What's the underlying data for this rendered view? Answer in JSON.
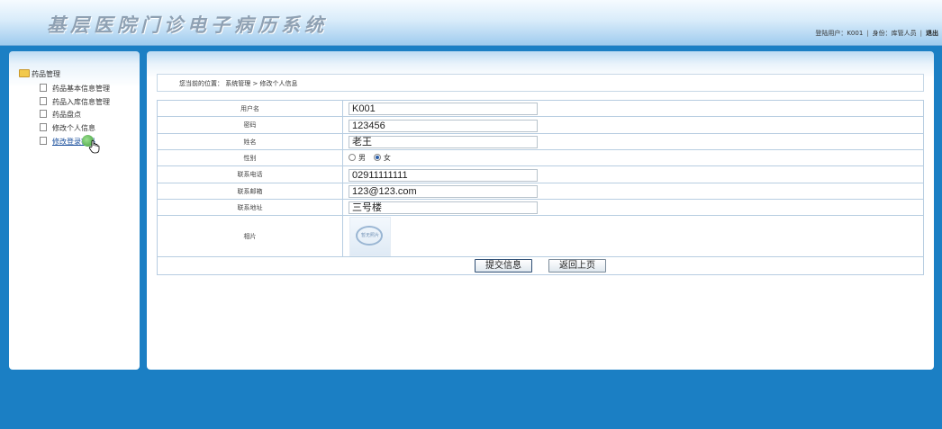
{
  "header": {
    "title": "基层医院门诊电子病历系统",
    "user_label": "登陆用户：K001",
    "role_label": "身份：库管人员",
    "logout": "退出"
  },
  "sidebar": {
    "root_label": "药品管理",
    "items": [
      {
        "label": "药品基本信息管理"
      },
      {
        "label": "药品入库信息管理"
      },
      {
        "label": "药品盘点"
      },
      {
        "label": "修改个人信息"
      },
      {
        "label": "修改登录密码"
      }
    ]
  },
  "breadcrumb": "您当前的位置：  系统管理 > 修改个人信息",
  "form": {
    "username": {
      "label": "用户名",
      "value": "K001"
    },
    "password": {
      "label": "密码",
      "value": "123456"
    },
    "name": {
      "label": "姓名",
      "value": "老王"
    },
    "gender": {
      "label": "性别",
      "male": "男",
      "female": "女",
      "selected": "女"
    },
    "phone": {
      "label": "联系电话",
      "value": "02911111111"
    },
    "email": {
      "label": "联系邮箱",
      "value": "123@123.com"
    },
    "address": {
      "label": "联系地址",
      "value": "三号楼"
    },
    "photo": {
      "label": "相片",
      "placeholder": "暂无照片"
    }
  },
  "buttons": {
    "submit": "提交信息",
    "back": "返回上页"
  }
}
